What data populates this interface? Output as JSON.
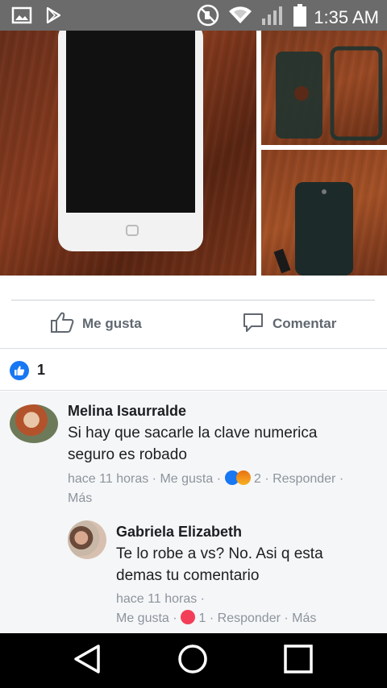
{
  "status_bar": {
    "time": "1:35 AM",
    "left_icons": [
      "image-icon",
      "play-store-icon"
    ],
    "right_icons": [
      "no-ringer-icon",
      "wifi-icon",
      "signal-icon",
      "battery-icon"
    ]
  },
  "post": {
    "photos": [
      "photo-white-phone",
      "photo-phone-cases",
      "photo-phone-case-back"
    ],
    "actions": {
      "like_label": "Me gusta",
      "comment_label": "Comentar"
    },
    "reactions": {
      "count": "1"
    }
  },
  "comments": [
    {
      "author": "Melina Isaurralde",
      "text_line1": "Si hay que sacarle la clave numerica",
      "text_line2": "seguro es robado",
      "time": "hace 11 horas",
      "like_label": "Me gusta",
      "reaction_count": "2",
      "reply_label": "Responder",
      "more_label": "Más"
    },
    {
      "author": "Gabriela Elizabeth",
      "text_line1": "Te lo robe a vs? No. Asi q esta",
      "text_line2": "demas tu comentario",
      "time": "hace 11 horas",
      "like_label": "Me gusta",
      "reaction_count": "1",
      "reply_label": "Responder",
      "more_label": "Más"
    }
  ],
  "colors": {
    "status_bar": "#6b6b6b",
    "fb_blue": "#1877f2",
    "meta_gray": "#8d949e",
    "comments_bg": "#f5f6f7"
  }
}
